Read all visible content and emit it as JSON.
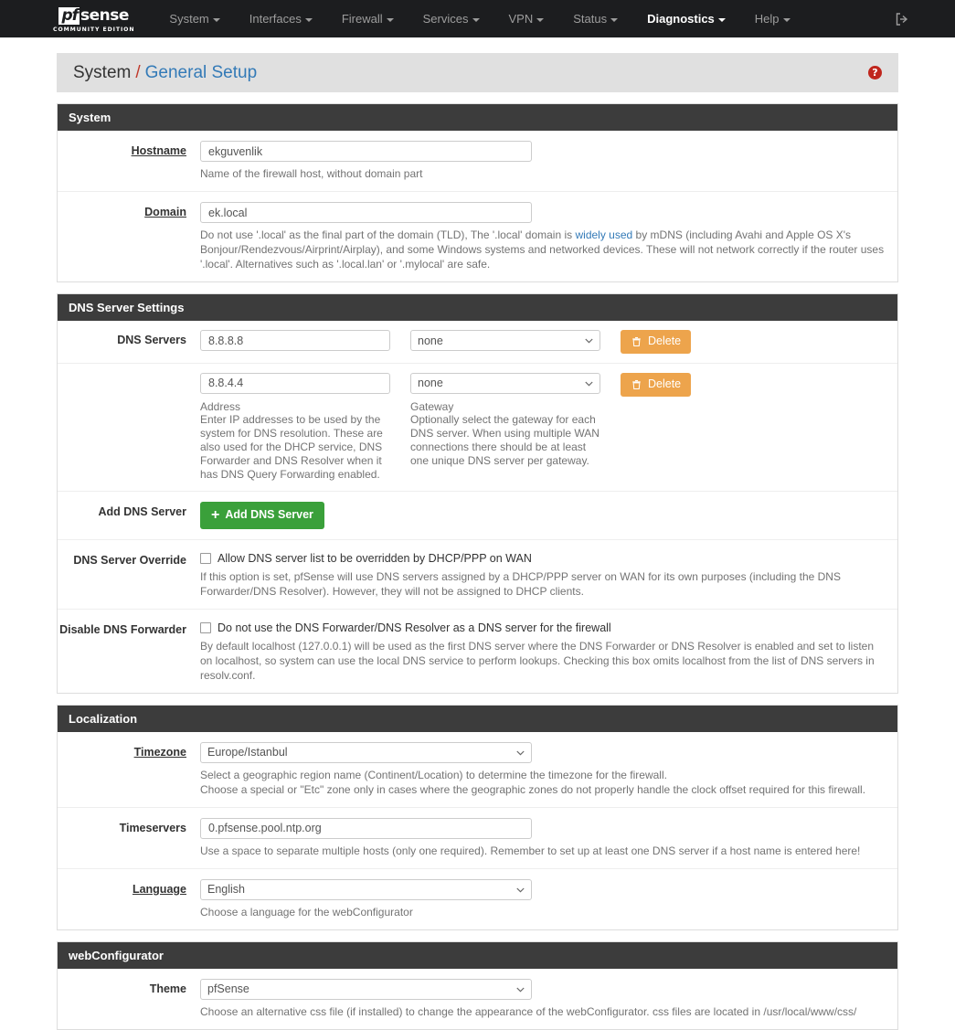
{
  "navbar": {
    "brand": {
      "pf": "pf",
      "sense": "sense",
      "subtitle": "COMMUNITY EDITION"
    },
    "items": [
      {
        "label": "System",
        "active": false
      },
      {
        "label": "Interfaces",
        "active": false
      },
      {
        "label": "Firewall",
        "active": false
      },
      {
        "label": "Services",
        "active": false
      },
      {
        "label": "VPN",
        "active": false
      },
      {
        "label": "Status",
        "active": false
      },
      {
        "label": "Diagnostics",
        "active": true
      },
      {
        "label": "Help",
        "active": false
      }
    ],
    "logout_icon": "sign-out-icon"
  },
  "breadcrumb": {
    "root": "System",
    "separator": "/",
    "current": "General Setup",
    "help_icon": "question-circle-icon",
    "help_glyph": "?"
  },
  "colors": {
    "navbar_bg": "#1c1d1f",
    "panel_heading_bg": "#3c3c3c",
    "link_blue": "#337ab7",
    "breadcrumb_sep": "#c0392b",
    "danger_orange": "#eda44c",
    "success_green": "#3aa03a",
    "help_red": "#c0261d"
  },
  "panels": {
    "system": {
      "title": "System",
      "hostname": {
        "label": "Hostname",
        "value": "ekguvenlik",
        "placeholder": "",
        "help": "Name of the firewall host, without domain part"
      },
      "domain": {
        "label": "Domain",
        "value": "ek.local",
        "placeholder": "",
        "help_part1": "Do not use '.local' as the final part of the domain (TLD), The '.local' domain is ",
        "help_link": "widely used",
        "help_part2": " by mDNS (including Avahi and Apple OS X's Bonjour/Rendezvous/Airprint/Airplay), and some Windows systems and networked devices. These will not network correctly if the router uses '.local'. Alternatives such as '.local.lan' or '.mylocal' are safe."
      }
    },
    "dns": {
      "title": "DNS Server Settings",
      "servers_label": "DNS Servers",
      "rows": [
        {
          "address": "8.8.8.8",
          "gateway": "none",
          "delete_label": "Delete"
        },
        {
          "address": "8.8.4.4",
          "gateway": "none",
          "delete_label": "Delete"
        }
      ],
      "gateway_options": [
        "none"
      ],
      "address_col_title": "Address",
      "address_col_desc": "Enter IP addresses to be used by the system for DNS resolution. These are also used for the DHCP service, DNS Forwarder and DNS Resolver when it has DNS Query Forwarding enabled.",
      "gateway_col_title": "Gateway",
      "gateway_col_desc": "Optionally select the gateway for each DNS server. When using multiple WAN connections there should be at least one unique DNS server per gateway.",
      "add_label": "Add DNS Server",
      "add_button_label": "Add DNS Server",
      "add_button_icon": "plus-icon",
      "delete_icon": "trash-icon",
      "override": {
        "label": "DNS Server Override",
        "checkbox_label": "Allow DNS server list to be overridden by DHCP/PPP on WAN",
        "checked": false,
        "help": "If this option is set, pfSense will use DNS servers assigned by a DHCP/PPP server on WAN for its own purposes (including the DNS Forwarder/DNS Resolver). However, they will not be assigned to DHCP clients."
      },
      "disable_forwarder": {
        "label": "Disable DNS Forwarder",
        "checkbox_label": "Do not use the DNS Forwarder/DNS Resolver as a DNS server for the firewall",
        "checked": false,
        "help": "By default localhost (127.0.0.1) will be used as the first DNS server where the DNS Forwarder or DNS Resolver is enabled and set to listen on localhost, so system can use the local DNS service to perform lookups. Checking this box omits localhost from the list of DNS servers in resolv.conf."
      }
    },
    "localization": {
      "title": "Localization",
      "timezone": {
        "label": "Timezone",
        "value": "Europe/Istanbul",
        "help_line1": "Select a geographic region name (Continent/Location) to determine the timezone for the firewall.",
        "help_line2": "Choose a special or \"Etc\" zone only in cases where the geographic zones do not properly handle the clock offset required for this firewall."
      },
      "timeservers": {
        "label": "Timeservers",
        "value": "0.pfsense.pool.ntp.org",
        "help": "Use a space to separate multiple hosts (only one required). Remember to set up at least one DNS server if a host name is entered here!"
      },
      "language": {
        "label": "Language",
        "value": "English",
        "help": "Choose a language for the webConfigurator"
      }
    },
    "webconfigurator": {
      "title": "webConfigurator",
      "theme": {
        "label": "Theme",
        "value": "pfSense",
        "help": "Choose an alternative css file (if installed) to change the appearance of the webConfigurator. css files are located in /usr/local/www/css/"
      }
    }
  }
}
